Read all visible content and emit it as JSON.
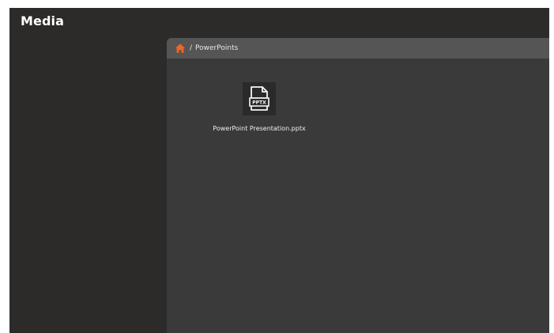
{
  "app": {
    "title": "Media"
  },
  "path_bar": {
    "home_icon": "home-icon",
    "separator": "/",
    "current_folder": "PowerPoints"
  },
  "files": [
    {
      "name": "PowerPoint Presentation.pptx",
      "icon": "pptx-file-icon",
      "icon_badge": "PPTX"
    }
  ],
  "colors": {
    "background": "#2c2b2a",
    "panel": "#3a3a3a",
    "path_bar": "#555555",
    "home_accent": "#f26522"
  }
}
